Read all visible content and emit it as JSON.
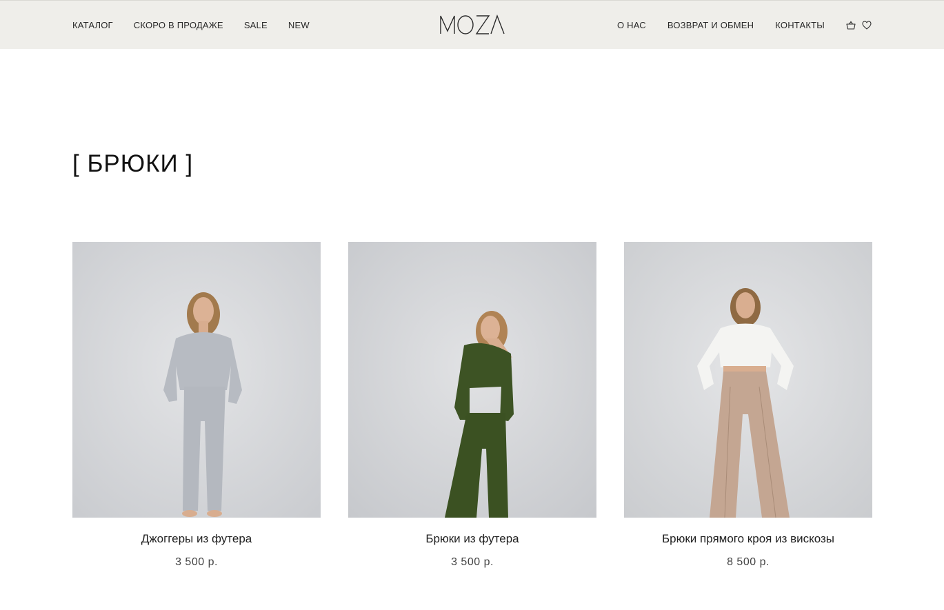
{
  "header": {
    "logo": "MOZA",
    "nav_left": [
      "КАТАЛОГ",
      "СКОРО В ПРОДАЖЕ",
      "SALE",
      "NEW"
    ],
    "nav_right": [
      "О НАС",
      "ВОЗВРАТ И ОБМЕН",
      "КОНТАКТЫ"
    ],
    "icons": [
      "cart-icon",
      "heart-icon"
    ]
  },
  "page": {
    "title": "[ БРЮКИ ]"
  },
  "products": [
    {
      "title": "Джоггеры из футера",
      "price": "3 500 р.",
      "color": "#b7bbc2"
    },
    {
      "title": "Брюки из футера",
      "price": "3 500 р.",
      "color": "#3d5324"
    },
    {
      "title": "Брюки прямого кроя из вискозы",
      "price": "8 500 р.",
      "color": "#c4a692"
    }
  ],
  "colors": {
    "header_bg": "#efeeea",
    "photo_bg": "#d7d9dc"
  }
}
